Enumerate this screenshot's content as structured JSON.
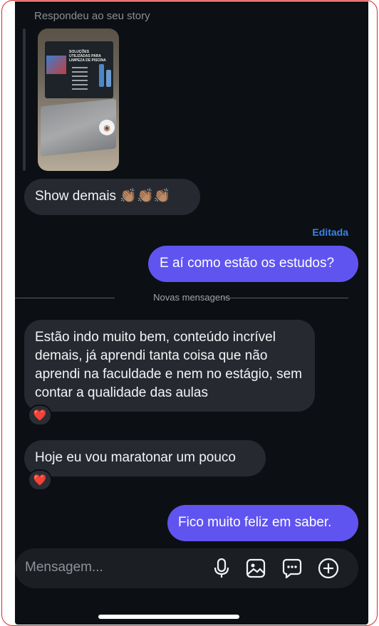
{
  "story": {
    "reply_label": "Respondeu ao seu story",
    "slide_title": "SOLUÇÕES UTILIZADAS PARA LIMPEZA DE PISCINA"
  },
  "messages": [
    {
      "id": "m1",
      "direction": "incoming",
      "text": "Show demais 👏🏽👏🏽👏🏽",
      "reaction": null
    },
    {
      "id": "m2",
      "direction": "outgoing",
      "text": "E aí como estão os estudos?",
      "status": "Editada"
    },
    {
      "id": "m3",
      "direction": "incoming",
      "text": "Estão indo muito bem, conteúdo incrível demais, já aprendi tanta coisa que não aprendi na faculdade e nem no estágio, sem contar a qualidade das aulas",
      "reaction": "❤️"
    },
    {
      "id": "m4",
      "direction": "incoming",
      "text": "Hoje eu vou maratonar um pouco",
      "reaction": "❤️"
    },
    {
      "id": "m5",
      "direction": "outgoing",
      "text": "Fico muito feliz em saber."
    }
  ],
  "divider": {
    "label": "Novas mensagens"
  },
  "composer": {
    "placeholder": "Mensagem...",
    "icons": [
      "microphone-icon",
      "image-icon",
      "sticker-icon",
      "add-icon"
    ]
  },
  "colors": {
    "background": "#0c1014",
    "incoming_bubble": "#262a30",
    "outgoing_bubble": "#6054f0",
    "edited_label": "#3a82e8",
    "heart": "#e0242f"
  }
}
